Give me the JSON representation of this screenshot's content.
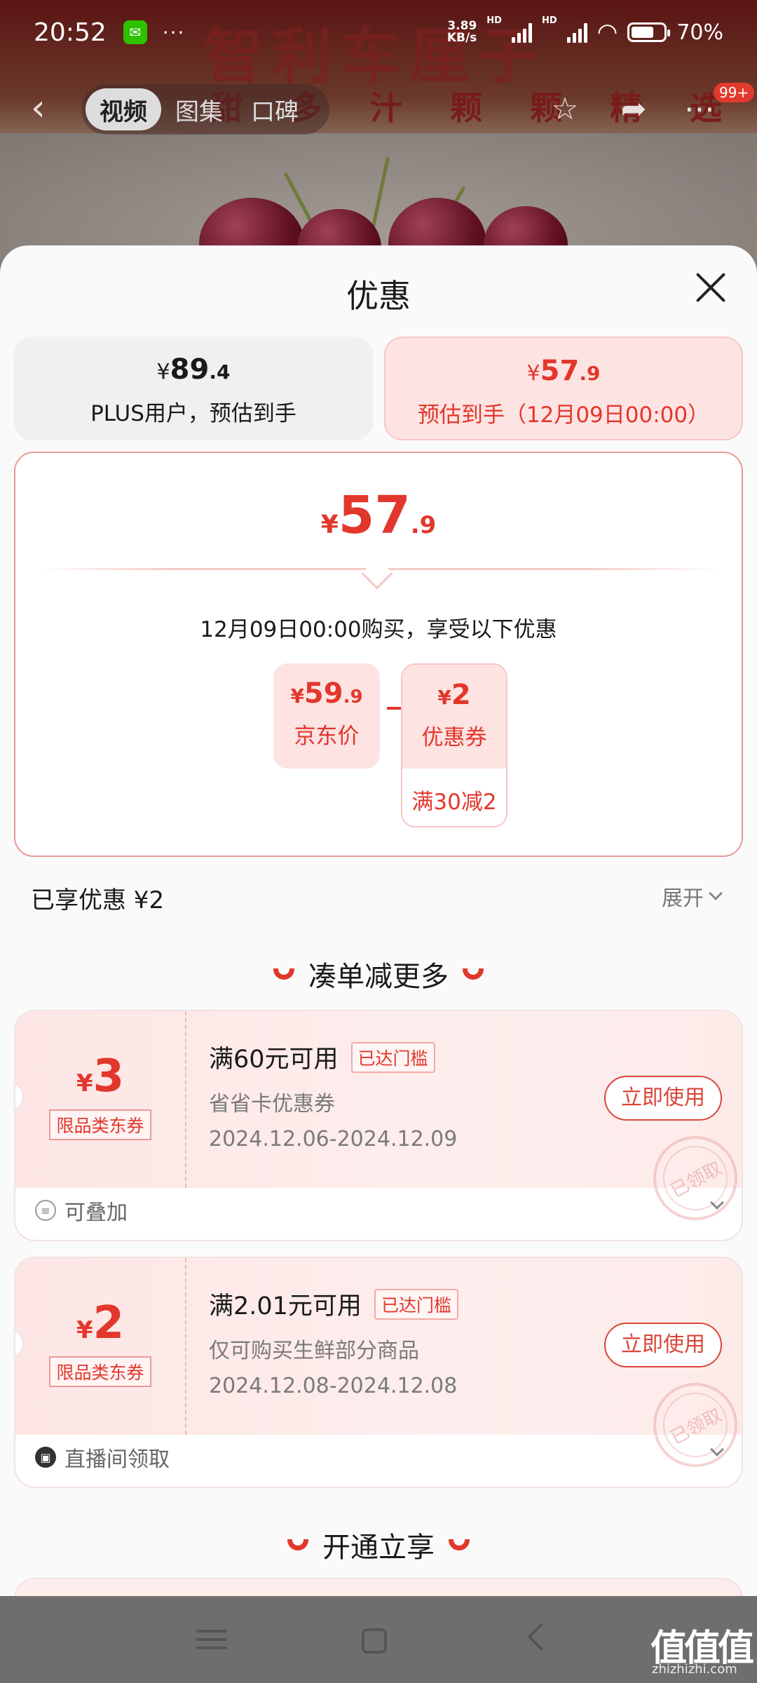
{
  "status_bar": {
    "time": "20:52",
    "more": "···",
    "speed_value": "3.89",
    "speed_unit": "KB/s",
    "hd1": "HD",
    "hd2": "HD",
    "battery_level": 0.7,
    "battery_text": "70%"
  },
  "background": {
    "brand_text": "智利车厘子",
    "slogan_text": "甜 多 汁   颗 颗 精 选"
  },
  "nav": {
    "tabs": [
      {
        "label": "视频",
        "active": true
      },
      {
        "label": "图集",
        "active": false
      },
      {
        "label": "口碑",
        "active": false
      }
    ],
    "badge": "99+"
  },
  "sheet": {
    "title": "优惠",
    "price_tabs": [
      {
        "yen": "¥",
        "int": "89",
        "dec": ".4",
        "label": "PLUS用户，预估到手"
      },
      {
        "yen": "¥",
        "int": "57",
        "dec": ".9",
        "label": "预估到手（12月09日00:00）"
      }
    ],
    "summary": {
      "yen": "¥",
      "int": "57",
      "dec": ".9",
      "description": "12月09日00:00购买，享受以下优惠",
      "jd_price": {
        "yen": "¥",
        "int": "59",
        "dec": ".9",
        "label": "京东价"
      },
      "coupon": {
        "yen": "¥",
        "int": "2",
        "label": "优惠券",
        "condition": "满30减2"
      }
    },
    "enjoyed": "已享优惠 ¥2",
    "expand": "展开",
    "section_more": "凑单减更多",
    "coupons": [
      {
        "yen": "¥",
        "amount": "3",
        "type": "限品类东券",
        "condition": "满60元可用",
        "tag": "已达门槛",
        "name": "省省卡优惠券",
        "dates": "2024.12.06-2024.12.09",
        "button": "立即使用",
        "stamp": "已领取",
        "footer_icon": "stack-icon",
        "footer": "可叠加"
      },
      {
        "yen": "¥",
        "amount": "2",
        "type": "限品类东券",
        "condition": "满2.01元可用",
        "tag": "已达门槛",
        "name": "仅可购买生鲜部分商品",
        "dates": "2024.12.08-2024.12.08",
        "button": "立即使用",
        "stamp": "已领取",
        "footer_icon": "live-icon",
        "footer": "直播间领取"
      }
    ],
    "section_open": "开通立享"
  },
  "watermark": {
    "text": "值值值",
    "url": "zhizhizhi.com"
  },
  "colors": {
    "accent": "#e2372c",
    "accent_bg": "#fde3e2",
    "overlay": "#6f6f6f"
  }
}
